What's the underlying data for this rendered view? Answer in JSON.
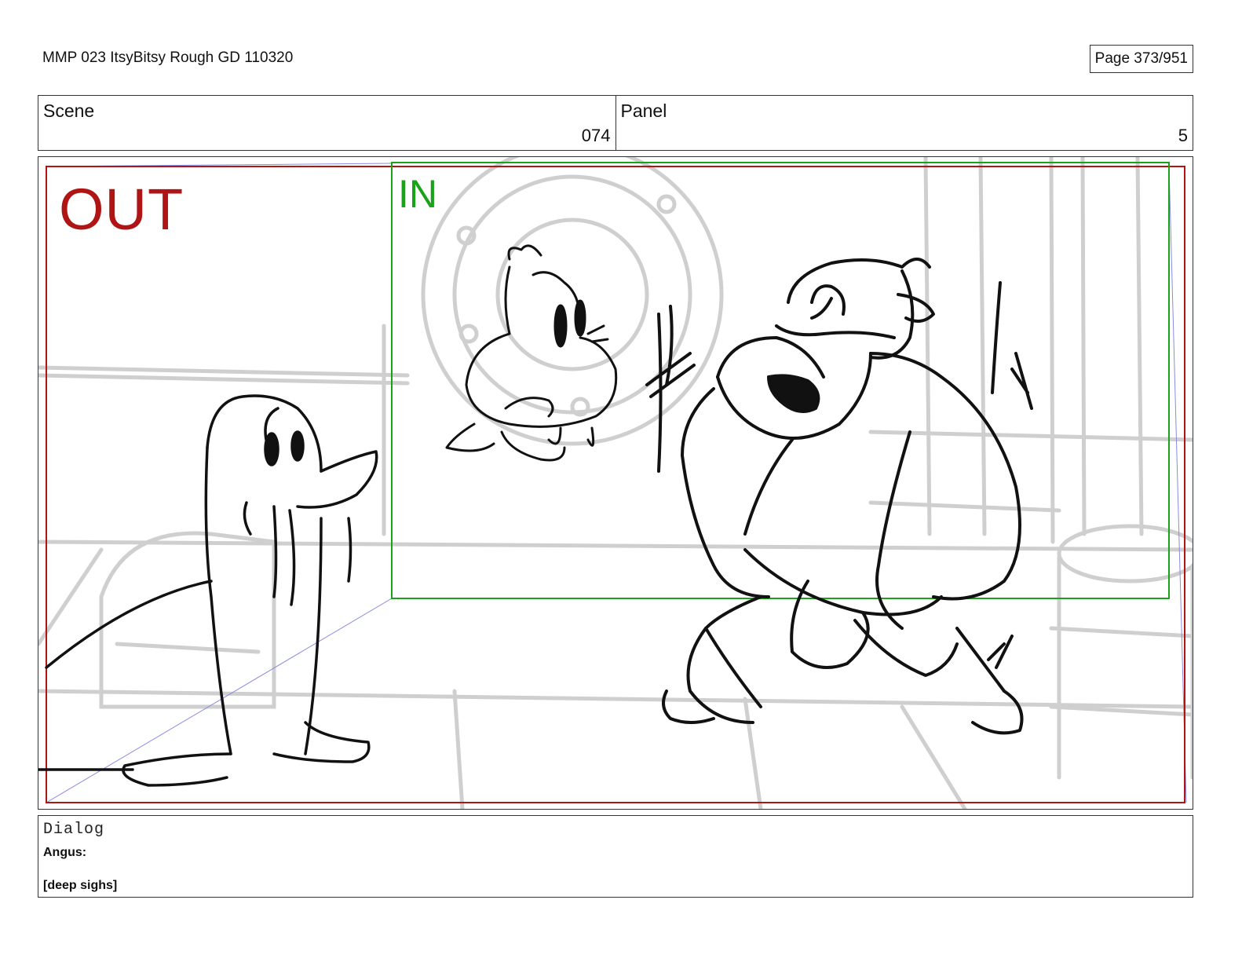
{
  "header": {
    "doc_title": "MMP 023 ItsyBitsy Rough GD 110320",
    "page": "Page 373/951"
  },
  "info": {
    "scene_label": "Scene",
    "scene_value": "074",
    "panel_label": "Panel",
    "panel_value": "5"
  },
  "frame": {
    "out_tag": "OUT",
    "in_tag": "IN",
    "colors": {
      "out": "#b01515",
      "in": "#1aa31a",
      "camera_guide": "#8a8ae0",
      "background_sketch": "#cfcfcf",
      "ink": "#111111"
    }
  },
  "dialog": {
    "label": "Dialog",
    "speaker": "Angus:",
    "line": "[deep sighs]"
  }
}
